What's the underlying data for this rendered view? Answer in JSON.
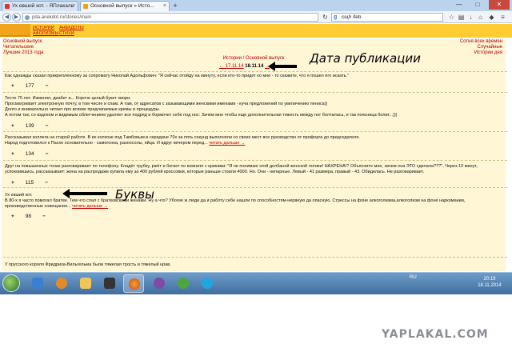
{
  "browser": {
    "tabs": [
      {
        "title": "Ух евший кот. - ЯПлакаль",
        "active": false
      },
      {
        "title": "Основной выпуск » Исто...",
        "active": true
      }
    ],
    "new_tab": "+",
    "window_buttons": {
      "minimize": "—",
      "maximize": "□",
      "close": "✕"
    },
    "url": "pda.anekdot.ru/stories/main",
    "search_text": "сщh ifeb",
    "nav_back": "◀",
    "nav_forward": "▶"
  },
  "site": {
    "nav_links": [
      "ИСТОРИИ",
      "АФОРИЗМЫ",
      "АНЕКДОТЫ",
      "СТИХИ"
    ],
    "left_links": [
      "Основной выпуск",
      "Читательские",
      "Лучшие 2013 года"
    ],
    "right_links": [
      "Сотня всех времен",
      "Случайные",
      "Истории дня"
    ],
    "section_link": "Истории / Основной выпуск",
    "date_prev": "← 17.11.14",
    "date_current": "18.11.14",
    "date_next": "→",
    "more_label": "читать дальше →"
  },
  "annotations": {
    "date_label": "Дата публикации",
    "letters_label": "Буквы"
  },
  "stories": [
    {
      "lines": [
        "Как однажды сказал прикрепленному за сопромату Николай Адольфович: \"Я сейчас отойду на минуту, если кто-то придет ко мне - то скажите, что я пошел его искать.\""
      ],
      "votes": {
        "plus": "+",
        "count": "177",
        "minus": "−"
      }
    },
    {
      "lines": [
        "Тесте 75 лет. Изменял, диабет и... Короче целый букет хвори.",
        "Просматривает электронную почту, в том числе и спам. А там, от адресатов с зазывающими женскими именами - куча предложений по увеличению пениса))",
        "Долго и внимательно читает про всякие предлагаемые кремы и процедуры.",
        "А потом так, со вздохом и видимым облегчением удаляет все подряд и бормочет себе под нос: Зачем мне чтобы еще дополнительная тяжесть между ног болталась, и так поясница болит...)))"
      ],
      "votes": {
        "plus": "+",
        "count": "139",
        "minus": "−"
      }
    },
    {
      "lines": [
        "Рассказывал коллега на старой работе. В их колхозе под Тамбовым в середине 70х за пять секунд выполняли со своих мест все руководство от профорга до председателя.",
        "Народ подготовился к Пасхе основательно - самогонка, разносолы, яйца. И вдруг вечером перед..."
      ],
      "has_more": true,
      "votes": {
        "plus": "+",
        "count": "134",
        "minus": "−"
      }
    },
    {
      "lines": [
        "Друг на повышенных тонах разговаривает по телефону. Кладёт трубку, ржёт и бегает по комнате с криками: \"Я не понимаю этой долбаной женской логики! НАХРЕНА!? Объясните мне, зачем она ЭТО сделала???\". Через 10 минут,",
        "успокоившись, рассказывает: жена на распродаже купила ему за 400 рублей кроссовки, которые раньше стоили 4000. Но. Они - непарные. Левый - 41 размера, правый - 43. Обиделась. Не разговаривает."
      ],
      "votes": {
        "plus": "+",
        "count": "115",
        "minus": "−"
      }
    },
    {
      "lines": [
        "Ух евший кот.",
        "В 80-х я часто помогал братве. Тем что спал с братковскими женами. Ну а что? Убогие ж люди да и работу себе нашли по способностям-нервную да опасную. Стрессы на фоне алкоголизма,алкоголизм на фоне наркомании,",
        "производственные совещания..."
      ],
      "has_more": true,
      "votes": {
        "plus": "+",
        "count": "98",
        "minus": "−"
      }
    },
    {
      "lines": [
        "У прусского короля Фридриха-Вильгельма были тяжелая трость и тяжелый нрав."
      ],
      "votes": null
    }
  ],
  "taskbar": {
    "lang": "RU",
    "time": "20:19",
    "date": "18.11.2014",
    "apps": [
      "explorer",
      "media",
      "folder",
      "video",
      "firefox",
      "viber",
      "torrent",
      "skype"
    ]
  },
  "watermark": "YAPLAKAL.COM",
  "colors": {
    "site_yellow": "#ffcc33",
    "page_bg": "#fff6d6",
    "link_red": "#c00000",
    "taskbar": "#3f6e9f"
  }
}
